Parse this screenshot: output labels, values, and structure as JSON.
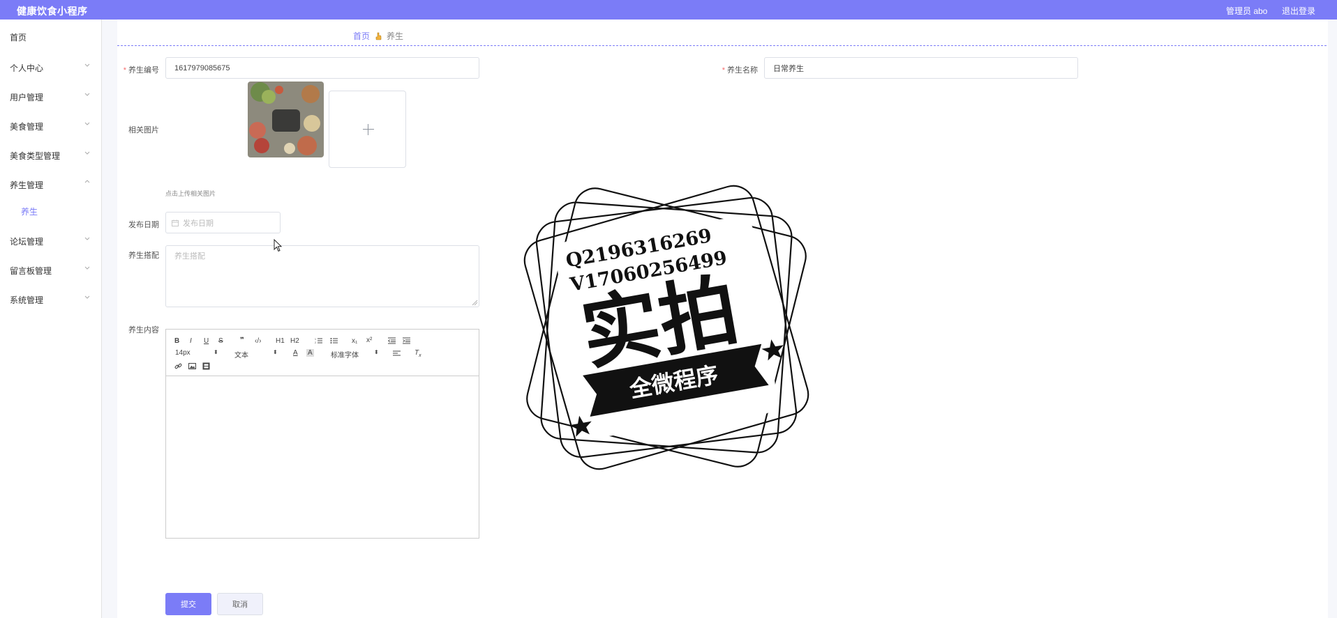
{
  "header": {
    "app_title": "健康饮食小程序",
    "admin_label": "管理员 abo",
    "logout_label": "退出登录",
    "accent_color": "#7b7cf7"
  },
  "sidebar": {
    "items": [
      {
        "label": "首页"
      },
      {
        "label": "个人中心"
      },
      {
        "label": "用户管理"
      },
      {
        "label": "美食管理"
      },
      {
        "label": "美食类型管理"
      },
      {
        "label": "养生管理"
      },
      {
        "label": "养生"
      },
      {
        "label": "论坛管理"
      },
      {
        "label": "留言板管理"
      },
      {
        "label": "系统管理"
      }
    ]
  },
  "breadcrumb": {
    "home": "首页",
    "current": "养生"
  },
  "form": {
    "code_label": "养生编号",
    "code_value": "1617979085675",
    "name_label": "养生名称",
    "name_value": "日常养生",
    "image_label": "相关图片",
    "upload_tip": "点击上传相关图片",
    "date_label": "发布日期",
    "date_placeholder": "发布日期",
    "pairing_label": "养生搭配",
    "pairing_placeholder": "养生搭配",
    "content_label": "养生内容",
    "submit_label": "提交",
    "cancel_label": "取消"
  },
  "editor": {
    "font_size": "14px",
    "block_format": "文本",
    "font_family": "标准字体",
    "h1": "H1",
    "h2": "H2",
    "sub": "x₁",
    "sup": "x²"
  },
  "watermark": {
    "line1": "Q2196316269",
    "line2": "V17060256499",
    "main_text": "实拍",
    "banner_text": "全微程序"
  }
}
